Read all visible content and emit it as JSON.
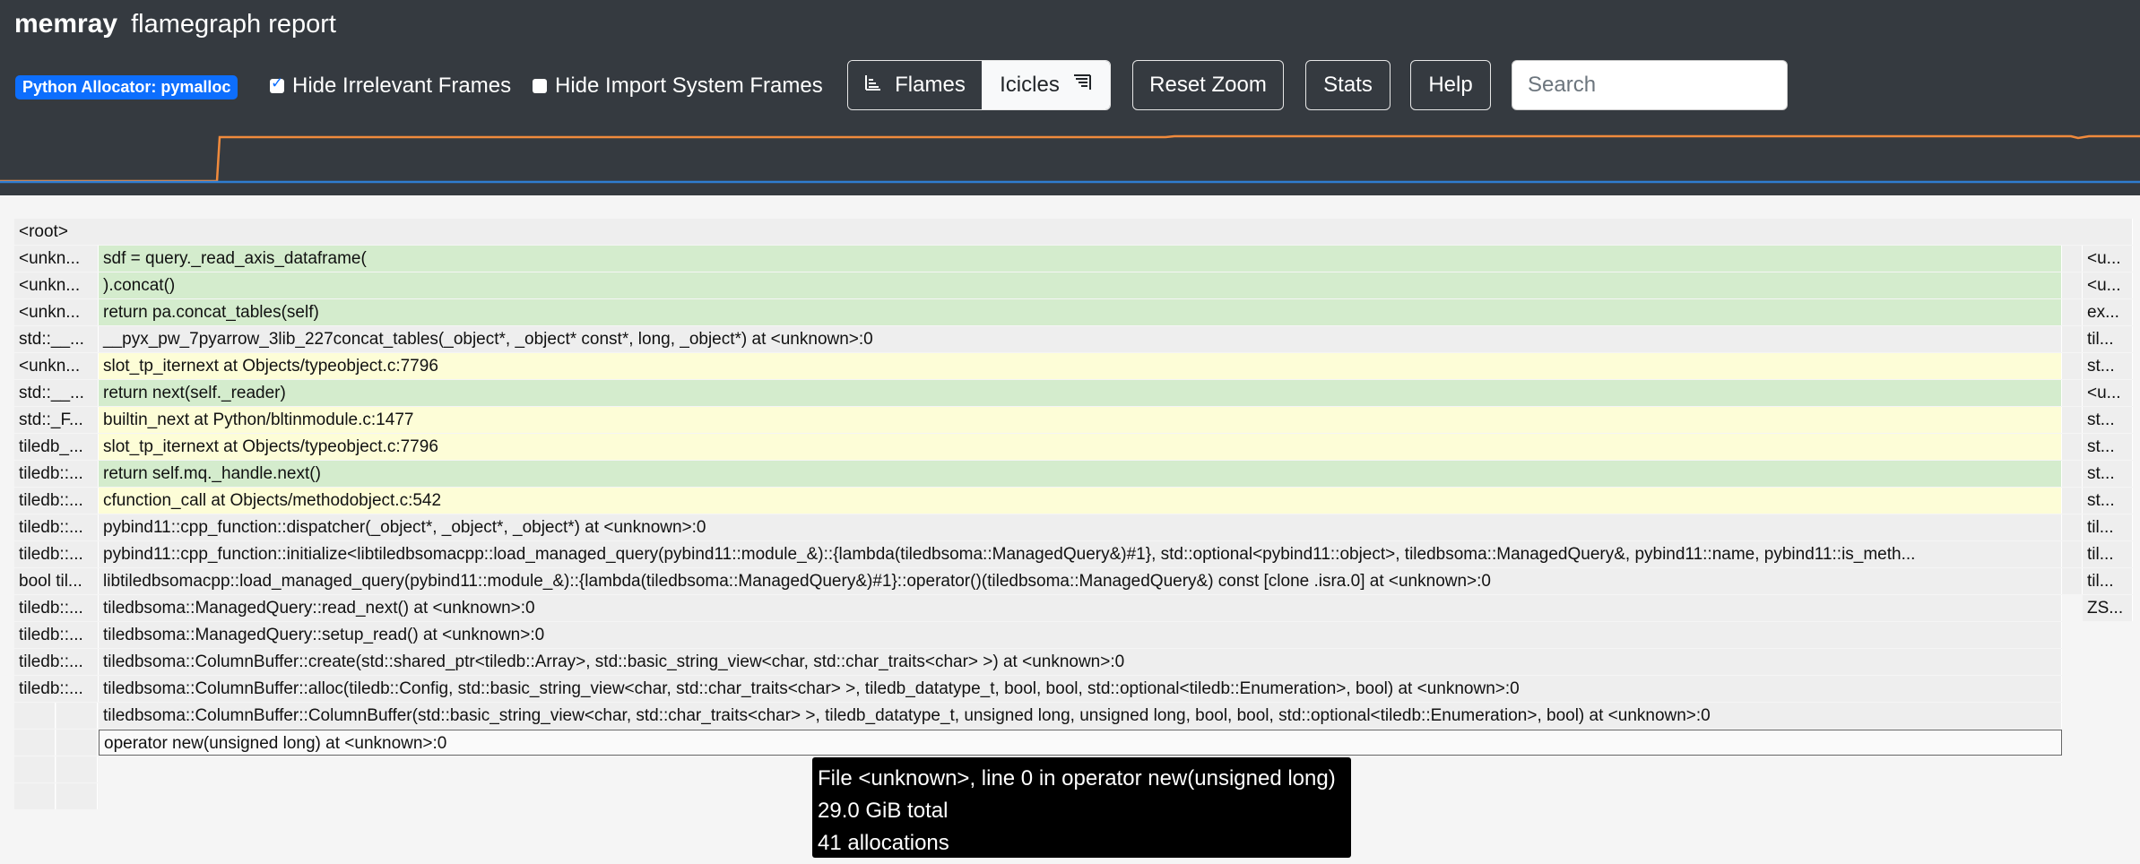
{
  "header": {
    "brand": "memray",
    "title": "flamegraph report"
  },
  "toolbar": {
    "allocator_badge": "Python Allocator: pymalloc",
    "hide_irrelevant_label": "Hide Irrelevant Frames",
    "hide_irrelevant_checked": true,
    "hide_import_label": "Hide Import System Frames",
    "hide_import_checked": false,
    "flames_label": "Flames",
    "icicles_label": "Icicles",
    "reset_zoom_label": "Reset Zoom",
    "stats_label": "Stats",
    "help_label": "Help",
    "search_placeholder": "Search",
    "search_value": ""
  },
  "colors": {
    "header_bg": "#353a40",
    "heap_line": "#f08a3c",
    "rss_line": "#2f7dd1",
    "frame_gray": "#eeeeee",
    "frame_green": "#d4eccd",
    "frame_yellow": "#fdfdd7",
    "badge_bg": "#0d6efd"
  },
  "flamegraph": {
    "root": "<root>",
    "rows": [
      {
        "left": "<unkn...",
        "main": "sdf = query._read_axis_dataframe(",
        "main_color": "green",
        "right": "<u..."
      },
      {
        "left": "<unkn...",
        "main": ").concat()",
        "main_color": "green",
        "right": "<u..."
      },
      {
        "left": "<unkn...",
        "main": "return pa.concat_tables(self)",
        "main_color": "green",
        "right": "ex..."
      },
      {
        "left": "std::__...",
        "main": "__pyx_pw_7pyarrow_3lib_227concat_tables(_object*, _object* const*, long, _object*) at <unknown>:0",
        "main_color": "gray",
        "right": "til..."
      },
      {
        "left": "<unkn...",
        "main": "slot_tp_iternext at Objects/typeobject.c:7796",
        "main_color": "yellow",
        "right": "st..."
      },
      {
        "left": "std::__...",
        "main": "return next(self._reader)",
        "main_color": "green",
        "right": "<u..."
      },
      {
        "left": "std::_F...",
        "main": "builtin_next at Python/bltinmodule.c:1477",
        "main_color": "yellow",
        "right": "st..."
      },
      {
        "left": "tiledb_...",
        "main": "slot_tp_iternext at Objects/typeobject.c:7796",
        "main_color": "yellow",
        "right": "st..."
      },
      {
        "left": "tiledb::...",
        "main": "return self.mq._handle.next()",
        "main_color": "green",
        "right": "st..."
      },
      {
        "left": "tiledb::...",
        "main": "cfunction_call at Objects/methodobject.c:542",
        "main_color": "yellow",
        "right": "st..."
      },
      {
        "left": "tiledb::...",
        "main": "pybind11::cpp_function::dispatcher(_object*, _object*, _object*) at <unknown>:0",
        "main_color": "gray",
        "right": "til..."
      },
      {
        "left": "tiledb::...",
        "main": "pybind11::cpp_function::initialize<libtiledbsomacpp::load_managed_query(pybind11::module_&)::{lambda(tiledbsoma::ManagedQuery&)#1}, std::optional<pybind11::object>, tiledbsoma::ManagedQuery&, pybind11::name, pybind11::is_meth...",
        "main_color": "gray",
        "right": "til..."
      },
      {
        "left": "bool til...",
        "main": "libtiledbsomacpp::load_managed_query(pybind11::module_&)::{lambda(tiledbsoma::ManagedQuery&)#1}::operator()(tiledbsoma::ManagedQuery&) const [clone .isra.0] at <unknown>:0",
        "main_color": "gray",
        "right": "til..."
      },
      {
        "left": "tiledb::...",
        "main": "tiledbsoma::ManagedQuery::read_next() at <unknown>:0",
        "main_color": "gray",
        "right": "ZS..."
      },
      {
        "left": "tiledb::...",
        "main": "tiledbsoma::ManagedQuery::setup_read() at <unknown>:0",
        "main_color": "gray",
        "right": ""
      },
      {
        "left": "tiledb::...",
        "main": "tiledbsoma::ColumnBuffer::create(std::shared_ptr<tiledb::Array>, std::basic_string_view<char, std::char_traits<char> >) at <unknown>:0",
        "main_color": "gray",
        "right": ""
      },
      {
        "left": "tiledb::...",
        "main": "tiledbsoma::ColumnBuffer::alloc(tiledb::Config, std::basic_string_view<char, std::char_traits<char> >, tiledb_datatype_t, bool, bool, std::optional<tiledb::Enumeration>, bool) at <unknown>:0",
        "main_color": "gray",
        "right": ""
      },
      {
        "left": "",
        "main": "tiledbsoma::ColumnBuffer::ColumnBuffer(std::basic_string_view<char, std::char_traits<char> >, tiledb_datatype_t, unsigned long, unsigned long, bool, bool, std::optional<tiledb::Enumeration>, bool) at <unknown>:0",
        "main_color": "gray",
        "right": ""
      },
      {
        "left": "",
        "main": "operator new(unsigned long) at <unknown>:0",
        "main_color": "selected",
        "right": ""
      }
    ]
  },
  "tooltip": {
    "line1": "File <unknown>, line 0 in operator new(unsigned long)",
    "line2": "29.0 GiB total",
    "line3": "41 allocations"
  }
}
